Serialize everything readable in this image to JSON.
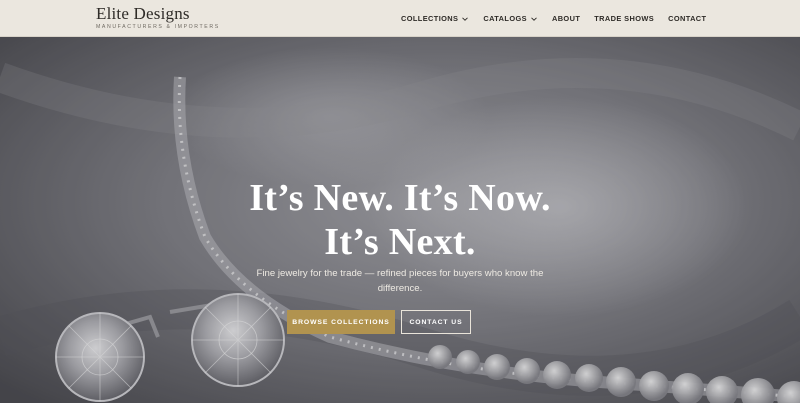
{
  "header": {
    "brand_name": "Elite Designs",
    "brand_tagline": "MANUFACTURERS & IMPORTERS",
    "nav": [
      {
        "label": "COLLECTIONS",
        "has_dropdown": true
      },
      {
        "label": "CATALOGS",
        "has_dropdown": true
      },
      {
        "label": "ABOUT",
        "has_dropdown": false
      },
      {
        "label": "TRADE SHOWS",
        "has_dropdown": false
      },
      {
        "label": "CONTACT",
        "has_dropdown": false
      }
    ]
  },
  "hero": {
    "headline_line1": "It’s New. It’s Now.",
    "headline_line2": "It’s Next.",
    "subtext": "Fine jewelry for the trade — refined pieces for buyers who know the difference.",
    "primary_button": "BROWSE COLLECTIONS",
    "secondary_button": "CONTACT US"
  },
  "colors": {
    "header_bg": "#ebe7df",
    "accent_gold": "#b1934f",
    "text_dark": "#2e2b27",
    "headline_white": "#ffffff"
  }
}
